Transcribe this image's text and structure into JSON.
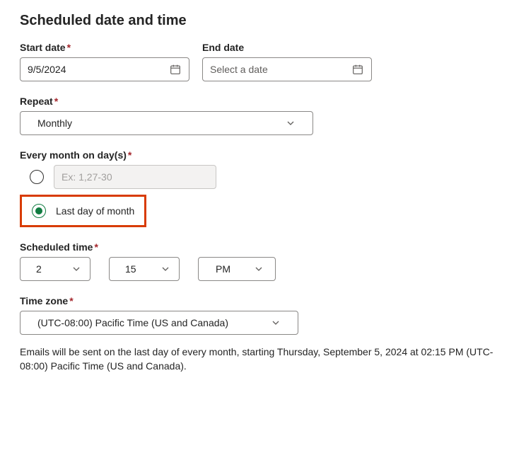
{
  "heading": "Scheduled date and time",
  "startDate": {
    "label": "Start date",
    "required": "*",
    "value": "9/5/2024"
  },
  "endDate": {
    "label": "End date",
    "placeholder": "Select a date"
  },
  "repeat": {
    "label": "Repeat",
    "required": "*",
    "value": "Monthly"
  },
  "monthDays": {
    "label": "Every month on day(s)",
    "required": "*",
    "placeholder": "Ex: 1,27-30",
    "lastDayLabel": "Last day of month"
  },
  "scheduledTime": {
    "label": "Scheduled time",
    "required": "*",
    "hour": "2",
    "minute": "15",
    "ampm": "PM"
  },
  "timeZone": {
    "label": "Time zone",
    "required": "*",
    "value": "(UTC-08:00) Pacific Time (US and Canada)"
  },
  "helper": "Emails will be sent on the last day of every month, starting Thursday, September 5, 2024 at 02:15 PM (UTC-08:00) Pacific Time (US and Canada)."
}
